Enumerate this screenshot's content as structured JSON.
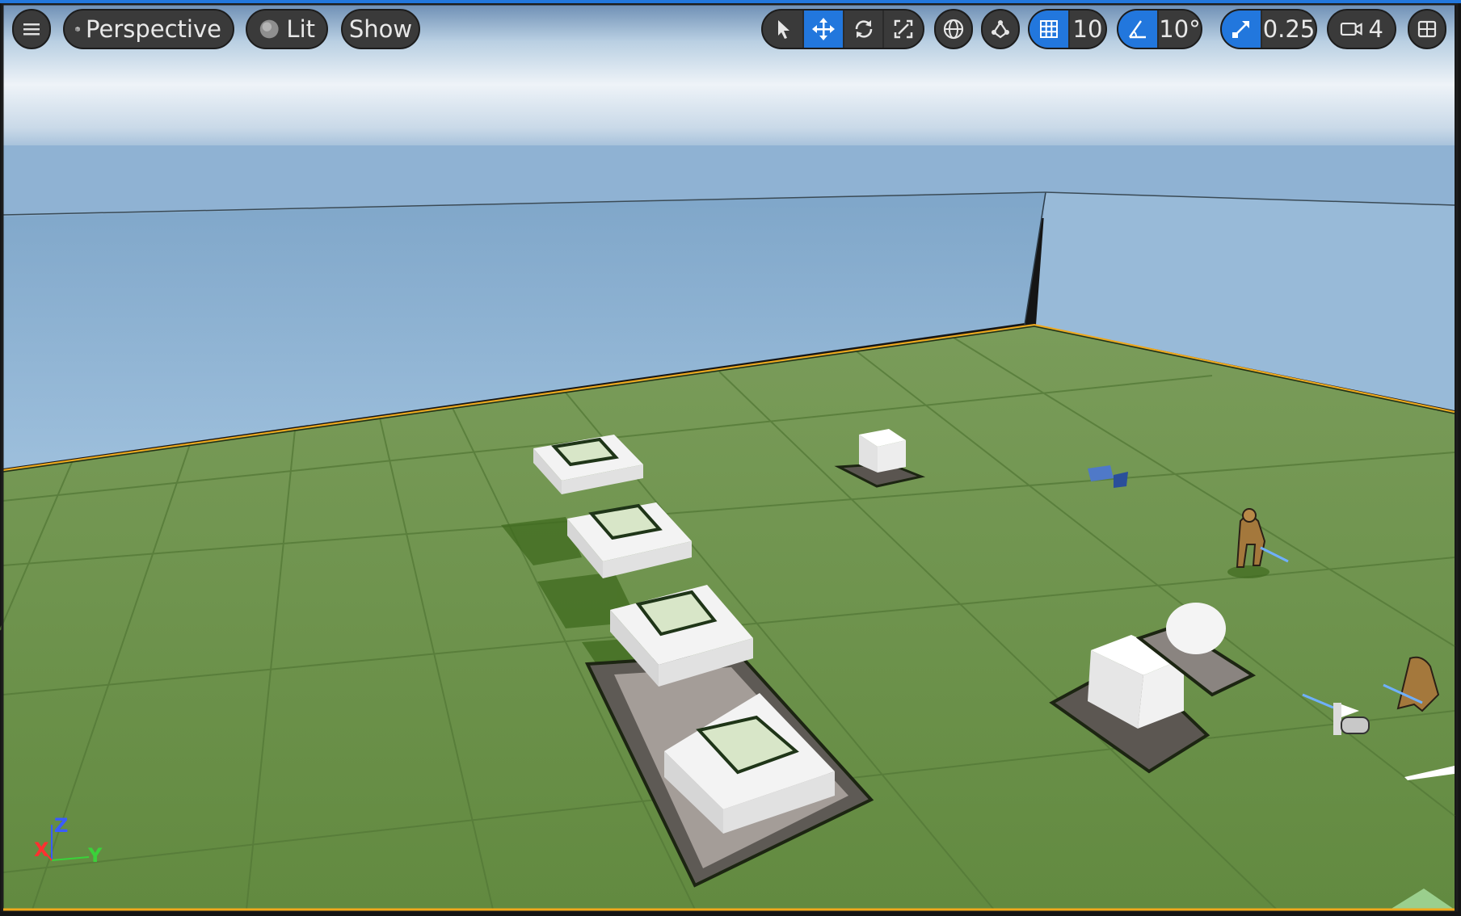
{
  "viewport": {
    "menu_icon": "hamburger-icon",
    "view_mode": {
      "label": "Perspective",
      "icon": "cube-icon"
    },
    "lighting": {
      "label": "Lit",
      "icon": "sphere-icon"
    },
    "show": {
      "label": "Show"
    },
    "transform_tools": [
      {
        "name": "select",
        "icon": "pointer-icon",
        "active": false
      },
      {
        "name": "translate",
        "icon": "move-arrows-icon",
        "active": true
      },
      {
        "name": "rotate",
        "icon": "rotate-icon",
        "active": false
      },
      {
        "name": "scale",
        "icon": "scale-icon",
        "active": false
      }
    ],
    "coordinate_space_icon": "globe-icon",
    "surface_snap_icon": "surface-snap-icon",
    "grid_snap": {
      "value": "10",
      "icon": "grid-icon",
      "enabled": true
    },
    "rotation_snap": {
      "value": "10°",
      "icon": "angle-icon",
      "enabled": true
    },
    "scale_snap": {
      "value": "0.25",
      "icon": "scale-snap-icon",
      "enabled": true
    },
    "camera_speed": {
      "value": "4",
      "icon": "camera-icon"
    },
    "layout_icon": "viewport-layout-icon",
    "axis_gizmo": {
      "x": "X",
      "y": "Y",
      "z": "Z"
    },
    "colors": {
      "accent": "#2277dd",
      "toolbar_bg": "#3a3a3a",
      "floor": "#6b9048",
      "wall": "#93b7d6",
      "sky_top": "#6e8fb5",
      "selection_outline": "#f0a81c",
      "axis_x": "#ff3030",
      "axis_y": "#3ad23a",
      "axis_z": "#3a5cff"
    }
  }
}
